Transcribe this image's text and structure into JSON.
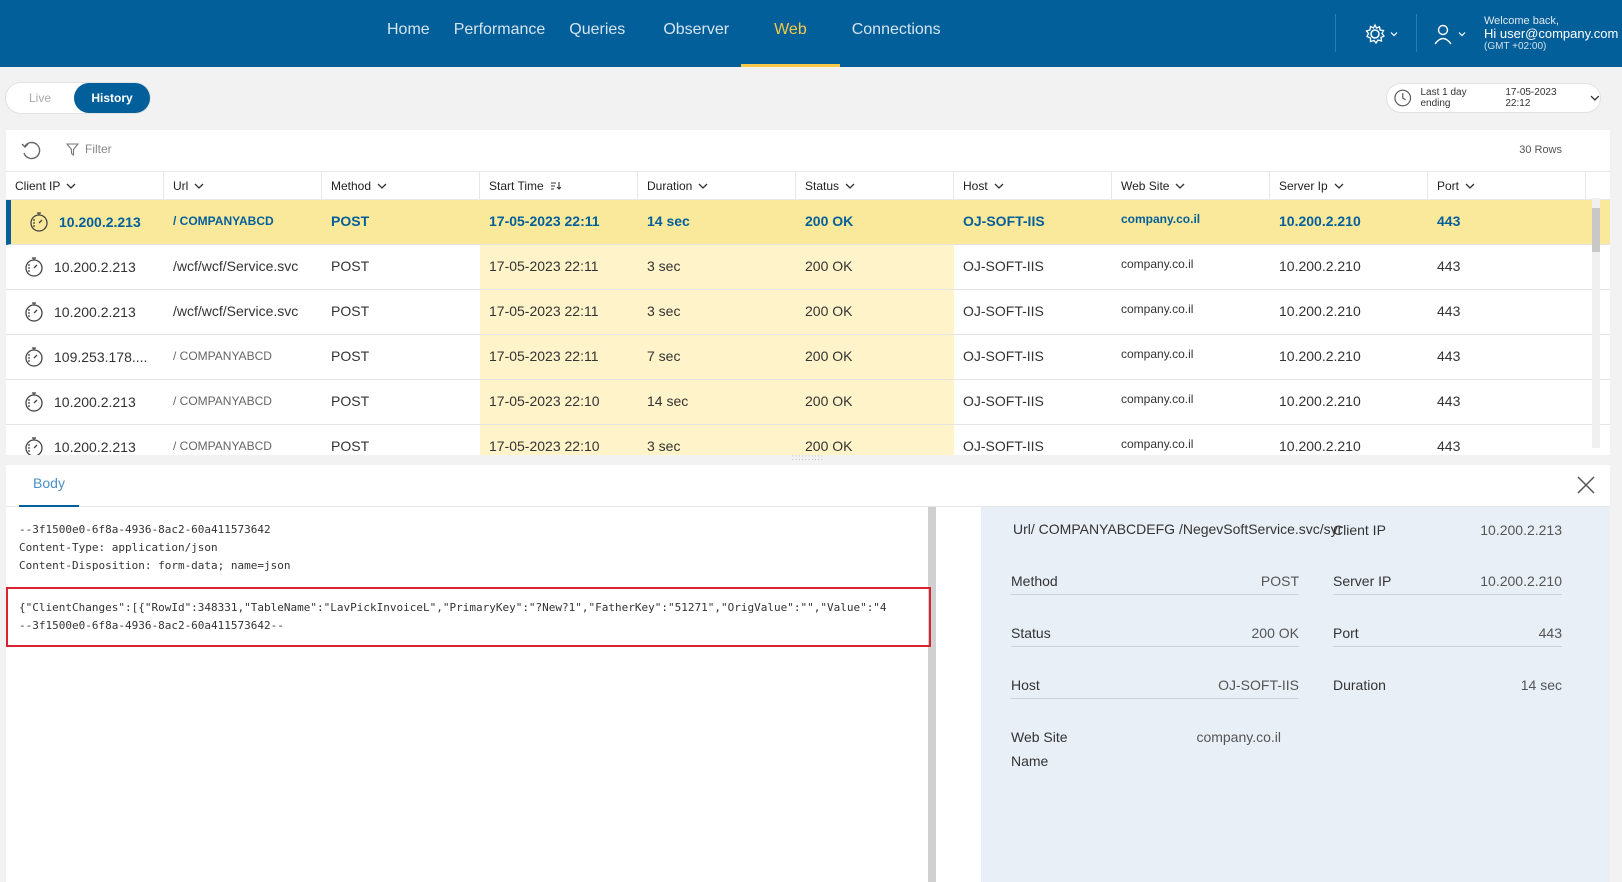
{
  "nav": {
    "items": [
      "Home",
      "Performance",
      "Queries",
      "Observer",
      "Web",
      "Connections"
    ],
    "active": "Web"
  },
  "user": {
    "welcome": "Welcome back,",
    "greeting": "Hi user@company.com",
    "timezone": "(GMT +02:00)"
  },
  "mode_toggle": {
    "live": "Live",
    "history": "History"
  },
  "time_range": {
    "label": "Last 1 day ending",
    "value": "17-05-2023 22:12"
  },
  "toolbar": {
    "filter": "Filter",
    "row_count": "30 Rows"
  },
  "table": {
    "columns": [
      "Client IP",
      "Url",
      "Method",
      "Start Time",
      "Duration",
      "Status",
      "Host",
      "Web Site",
      "Server Ip",
      "Port"
    ],
    "rows": [
      [
        "10.200.2.213",
        "/ COMPANYABCD",
        "POST",
        "17-05-2023 22:11",
        "14 sec",
        "200 OK",
        "OJ-SOFT-IIS",
        "company.co.il",
        "10.200.2.210",
        "443"
      ],
      [
        "10.200.2.213",
        "/wcf/wcf/Service.svc",
        "POST",
        "17-05-2023 22:11",
        "3 sec",
        "200 OK",
        "OJ-SOFT-IIS",
        "company.co.il",
        "10.200.2.210",
        "443"
      ],
      [
        "10.200.2.213",
        "/wcf/wcf/Service.svc",
        "POST",
        "17-05-2023 22:11",
        "3 sec",
        "200 OK",
        "OJ-SOFT-IIS",
        "company.co.il",
        "10.200.2.210",
        "443"
      ],
      [
        "109.253.178....",
        "/  COMPANYABCD",
        "POST",
        "17-05-2023 22:11",
        "7 sec",
        "200 OK",
        "OJ-SOFT-IIS",
        "company.co.il",
        "10.200.2.210",
        "443"
      ],
      [
        "10.200.2.213",
        "/  COMPANYABCD",
        "POST",
        "17-05-2023 22:10",
        "14 sec",
        "200 OK",
        "OJ-SOFT-IIS",
        "company.co.il",
        "10.200.2.210",
        "443"
      ],
      [
        "10.200.2.213",
        "/  COMPANYABCD",
        "POST",
        "17-05-2023 22:10",
        "3 sec",
        "200 OK",
        "OJ-SOFT-IIS",
        "company.co.il",
        "10.200.2.210",
        "443"
      ]
    ]
  },
  "body_tab": {
    "label": "Body"
  },
  "body": {
    "lines": [
      "--3f1500e0-6f8a-4936-8ac2-60a411573642",
      "Content-Type: application/json",
      "Content-Disposition: form-data; name=json"
    ],
    "json_line": "{\"ClientChanges\":[{\"RowId\":348331,\"TableName\":\"LavPickInvoiceL\",\"PrimaryKey\":\"?New?1\",\"FatherKey\":\"51271\",\"OrigValue\":\"\",\"Value\":\"4",
    "end_line": "--3f1500e0-6f8a-4936-8ac2-60a411573642--"
  },
  "details": {
    "url_label": "Url/",
    "url_value": "COMPANYABCDEFG /NegevSoftService.svc/sync",
    "client_ip_label": "Client IP",
    "client_ip": "10.200.2.213",
    "method_label": "Method",
    "method": "POST",
    "server_ip_label": "Server IP",
    "server_ip": "10.200.2.210",
    "status_label": "Status",
    "status": "200 OK",
    "port_label": "Port",
    "port": "443",
    "host_label": "Host",
    "host": "OJ-SOFT-IIS",
    "duration_label": "Duration",
    "duration": "14 sec",
    "website_label": "Web Site Name",
    "website": "company.co.il"
  },
  "colors": {
    "brand": "#035f99",
    "accent": "#f7c948",
    "selected_row": "#fbe99b",
    "highlight": "#d9232f"
  }
}
